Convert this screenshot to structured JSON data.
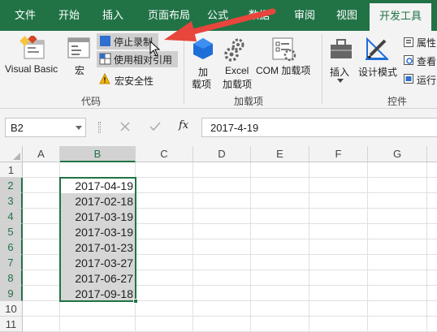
{
  "tabs": [
    "文件",
    "开始",
    "插入",
    "页面布局",
    "公式",
    "数据",
    "审阅",
    "视图",
    "开发工具"
  ],
  "ribbon": {
    "code_group": {
      "visual_basic": "Visual Basic",
      "macros": "宏",
      "stop_recording": "停止录制",
      "relative_refs": "使用相对引用",
      "macro_security": "宏安全性",
      "label": "代码"
    },
    "addins_group": {
      "addins_line1": "加",
      "addins_line2": "载项",
      "excel_addins_line1": "Excel",
      "excel_addins_line2": "加载项",
      "com_addins": "COM 加载项",
      "label": "加载项"
    },
    "controls_group": {
      "insert": "插入",
      "design_mode": "设计模式",
      "properties": "属性",
      "view_code": "查看",
      "run_dialog": "运行",
      "label": "控件"
    }
  },
  "formula_bar": {
    "name_box": "B2",
    "fx": "fx",
    "formula": "2017-4-19"
  },
  "sheet": {
    "columns": [
      "A",
      "B",
      "C",
      "D",
      "E",
      "F",
      "G"
    ],
    "rows": [
      "1",
      "2",
      "3",
      "4",
      "5",
      "6",
      "7",
      "8",
      "9",
      "10",
      "11"
    ],
    "selected_column": "B",
    "b_values": [
      "2017-04-19",
      "2017-02-18",
      "2017-03-19",
      "2017-03-19",
      "2017-01-23",
      "2017-03-27",
      "2017-06-27",
      "2017-09-18"
    ]
  },
  "colors": {
    "excel_green": "#217346",
    "annotation_arrow": "#e8453c"
  }
}
